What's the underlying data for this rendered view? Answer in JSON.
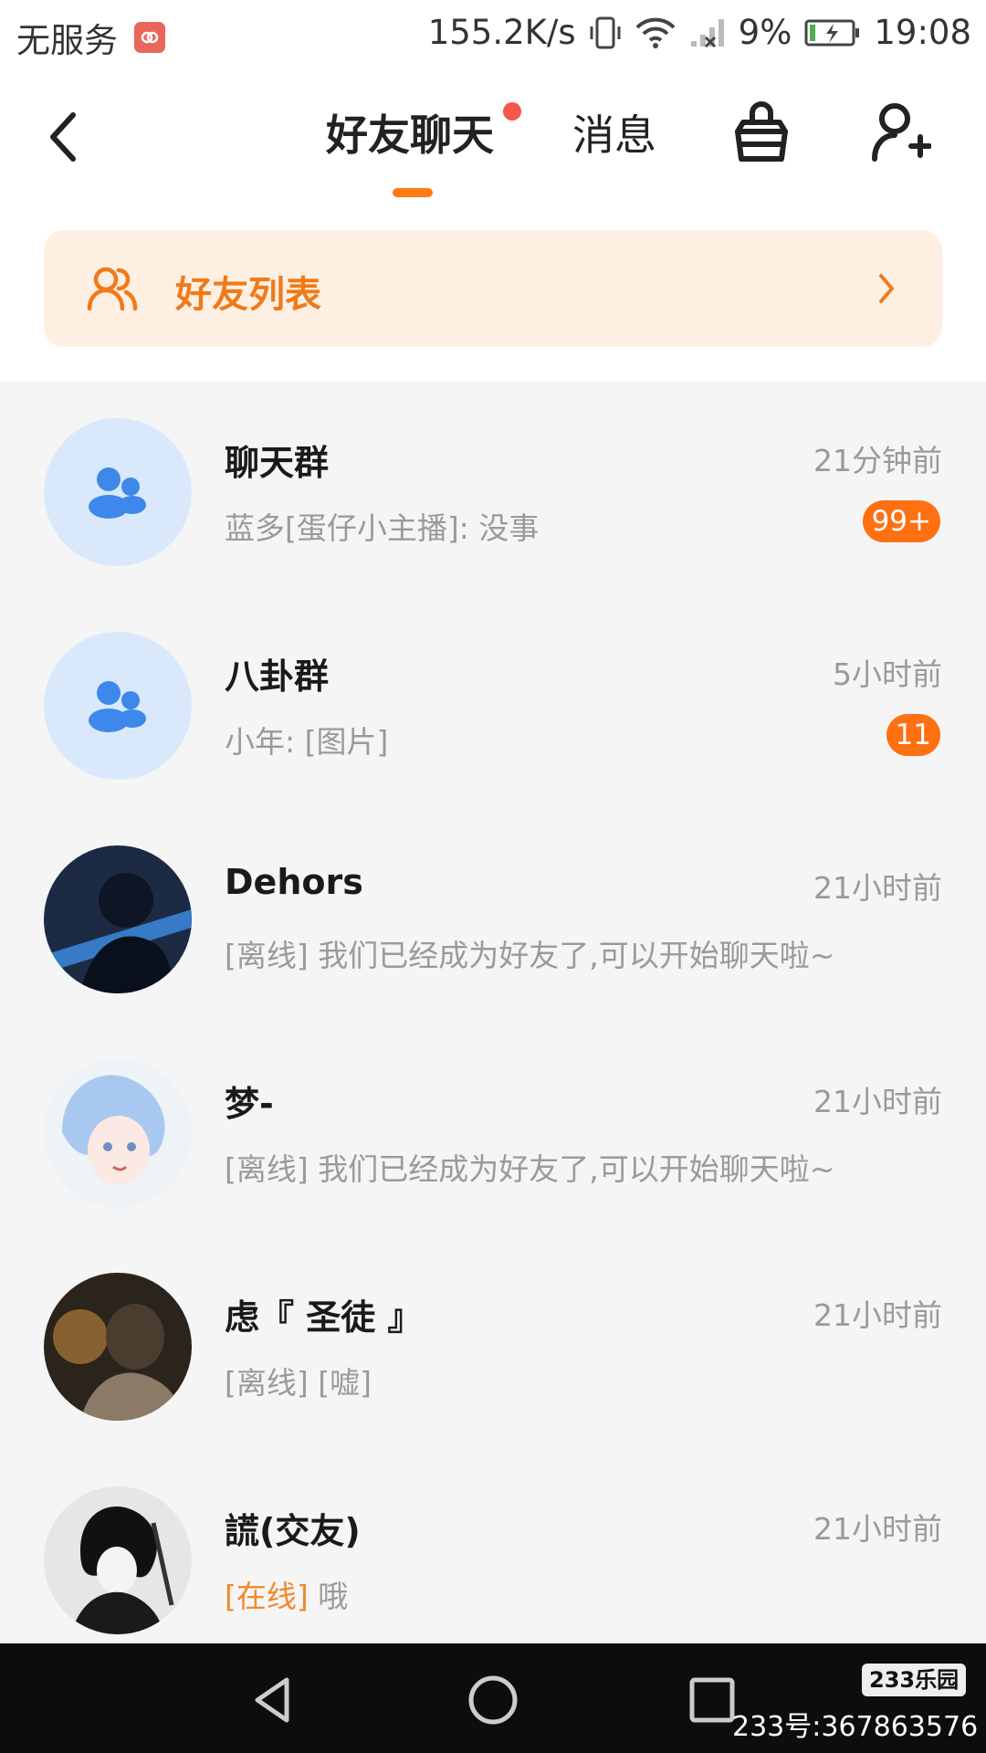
{
  "status_bar": {
    "carrier": "无服务",
    "speed": "155.2K/s",
    "battery": "9%",
    "time": "19:08"
  },
  "nav": {
    "tabs": [
      "好友聊天",
      "消息"
    ],
    "active_tab": "好友聊天",
    "accent": "#ff7a13"
  },
  "banner": {
    "label": "好友列表"
  },
  "chats": [
    {
      "name": "聊天群",
      "time": "21分钟前",
      "preview": "蓝多[蛋仔小主播]: 没事",
      "badge": "99+",
      "avatar": "group-icon"
    },
    {
      "name": "八卦群",
      "time": "5小时前",
      "preview": "小年: [图片]",
      "badge": "11",
      "avatar": "group-icon"
    },
    {
      "name": "Dehors",
      "time": "21小时前",
      "preview": "[离线] 我们已经成为好友了,可以开始聊天啦~"
    },
    {
      "name": "梦-",
      "time": "21小时前",
      "preview": "[离线] 我们已经成为好友了,可以开始聊天啦~"
    },
    {
      "name": "虑『 圣徒 』",
      "time": "21小时前",
      "preview": "[离线] [嘘]"
    },
    {
      "name": "謊(交友)",
      "time": "21小时前",
      "status": "[在线]",
      "preview": " 哦"
    }
  ],
  "watermark": {
    "logo": "233乐园",
    "id": "233号:367863576"
  }
}
